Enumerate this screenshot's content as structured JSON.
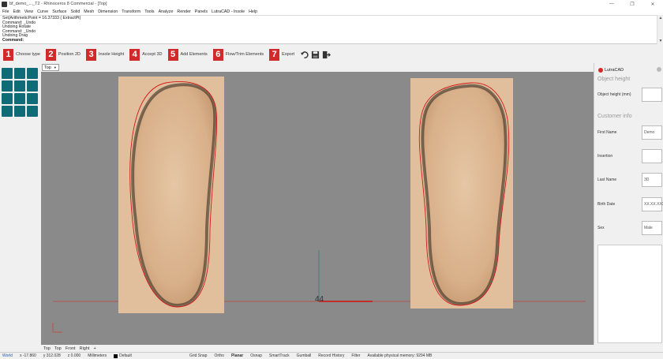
{
  "window": {
    "title": "bf_demo_..._T2 - Rhinoceros 8 Commercial - [Top]",
    "min": "—",
    "max": "❐",
    "close": "✕"
  },
  "menu": [
    "File",
    "Edit",
    "View",
    "Curve",
    "Surface",
    "Solid",
    "Mesh",
    "Dimension",
    "Transform",
    "Tools",
    "Analyze",
    "Render",
    "Panels",
    "LutraCAD - Insole",
    "Help"
  ],
  "command_history": [
    "Set(ArithmeticPoint = 16.37333 ( ExtractPt)",
    "Command: _Undo",
    "Undoing Rotate",
    "Command: _Undo",
    "Undoing Drag"
  ],
  "command_prompt": "Command:",
  "toolbar": {
    "steps": [
      {
        "num": "1",
        "label": "Choose type"
      },
      {
        "num": "2",
        "label": "Position 2D"
      },
      {
        "num": "3",
        "label": "Insole Height"
      },
      {
        "num": "4",
        "label": "Accept 3D"
      },
      {
        "num": "5",
        "label": "Add Elements"
      },
      {
        "num": "6",
        "label": "Flow/Trim Elements"
      },
      {
        "num": "7",
        "label": "Export"
      }
    ],
    "icons": [
      "undo-icon",
      "save-icon",
      "exit-icon"
    ]
  },
  "viewport": {
    "tab_label": "Top",
    "center_label": "44"
  },
  "right_panel": {
    "logo": "LutraCAD",
    "section_height": "Object height",
    "height_label": "Object height (mm)",
    "height_value": "",
    "section_customer": "Customer info",
    "fields": [
      {
        "label": "First Name",
        "value": "Demo"
      },
      {
        "label": "Insertion",
        "value": ""
      },
      {
        "label": "Last Name",
        "value": "3D"
      },
      {
        "label": "Birth Date",
        "value": "XX.XX.XXXX"
      },
      {
        "label": "Sex",
        "value": "Male"
      }
    ]
  },
  "view_tabs": [
    "Top",
    "Top",
    "Front",
    "Right",
    "+"
  ],
  "status": {
    "cplane": "World",
    "x": "x -17.860",
    "y": "y 312.028",
    "z": "z 0.000",
    "units": "Millimeters",
    "layer": "Default",
    "toggles": [
      "Grid Snap",
      "Ortho",
      "Planar",
      "Osnap",
      "SmartTrack",
      "Gumball",
      "Record History",
      "Filter"
    ],
    "memory": "Available physical memory: 9294 MB"
  }
}
